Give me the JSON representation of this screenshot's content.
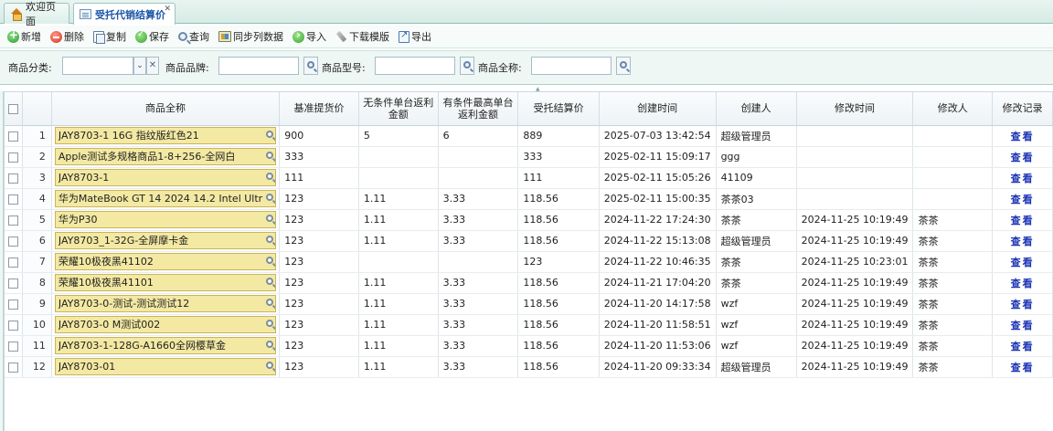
{
  "tabs": [
    {
      "label": "欢迎页面",
      "icon": "home-icon",
      "active": false
    },
    {
      "label": "受托代销结算价",
      "icon": "document-icon",
      "active": true
    }
  ],
  "toolbar": {
    "add": "新增",
    "delete": "删除",
    "copy": "复制",
    "save": "保存",
    "query": "查询",
    "sync": "同步列数据",
    "import": "导入",
    "download_template": "下载模版",
    "export": "导出"
  },
  "search": {
    "category_label": "商品分类:",
    "category_value": "",
    "brand_label": "商品品牌:",
    "brand_value": "",
    "model_label": "商品型号:",
    "model_value": "",
    "fullname_label": "商品全称:",
    "fullname_value": ""
  },
  "grid": {
    "columns": [
      "商品全称",
      "基准提货价",
      "无条件单台返利金额",
      "有条件最高单台返利金额",
      "受托结算价",
      "创建时间",
      "创建人",
      "修改时间",
      "修改人",
      "修改记录"
    ],
    "view_label": "查看",
    "rows": [
      {
        "no": "1",
        "name": "JAY8703-1 16G 指纹版红色21",
        "base_price": "900",
        "uncond_rebate": "5",
        "cond_rebate": "6",
        "settle_price": "889",
        "created": "2025-07-03 13:42:54",
        "creator": "超级管理员",
        "modified": "",
        "modifier": ""
      },
      {
        "no": "2",
        "name": "Apple测试多规格商品1-8+256-全网白",
        "base_price": "333",
        "uncond_rebate": "",
        "cond_rebate": "",
        "settle_price": "333",
        "created": "2025-02-11 15:09:17",
        "creator": "ggg",
        "modified": "",
        "modifier": ""
      },
      {
        "no": "3",
        "name": "JAY8703-1",
        "base_price": "111",
        "uncond_rebate": "",
        "cond_rebate": "",
        "settle_price": "111",
        "created": "2025-02-11 15:05:26",
        "creator": "41109",
        "modified": "",
        "modifier": ""
      },
      {
        "no": "4",
        "name": "华为MateBook GT 14 2024 14.2 Intel Ultr",
        "base_price": "123",
        "uncond_rebate": "1.11",
        "cond_rebate": "3.33",
        "settle_price": "118.56",
        "created": "2025-02-11 15:00:35",
        "creator": "茶茶03",
        "modified": "",
        "modifier": ""
      },
      {
        "no": "5",
        "name": "华为P30",
        "base_price": "123",
        "uncond_rebate": "1.11",
        "cond_rebate": "3.33",
        "settle_price": "118.56",
        "created": "2024-11-22 17:24:30",
        "creator": "茶茶",
        "modified": "2024-11-25 10:19:49",
        "modifier": "茶茶"
      },
      {
        "no": "6",
        "name": "JAY8703_1-32G-全屏摩卡金",
        "base_price": "123",
        "uncond_rebate": "1.11",
        "cond_rebate": "3.33",
        "settle_price": "118.56",
        "created": "2024-11-22 15:13:08",
        "creator": "超级管理员",
        "modified": "2024-11-25 10:19:49",
        "modifier": "茶茶"
      },
      {
        "no": "7",
        "name": "荣耀10极夜黑41102",
        "base_price": "123",
        "uncond_rebate": "",
        "cond_rebate": "",
        "settle_price": "123",
        "created": "2024-11-22 10:46:35",
        "creator": "茶茶",
        "modified": "2024-11-25 10:23:01",
        "modifier": "茶茶"
      },
      {
        "no": "8",
        "name": "荣耀10极夜黑41101",
        "base_price": "123",
        "uncond_rebate": "1.11",
        "cond_rebate": "3.33",
        "settle_price": "118.56",
        "created": "2024-11-21 17:04:20",
        "creator": "茶茶",
        "modified": "2024-11-25 10:19:49",
        "modifier": "茶茶"
      },
      {
        "no": "9",
        "name": "JAY8703-0-测试-测试测试12",
        "base_price": "123",
        "uncond_rebate": "1.11",
        "cond_rebate": "3.33",
        "settle_price": "118.56",
        "created": "2024-11-20 14:17:58",
        "creator": "wzf",
        "modified": "2024-11-25 10:19:49",
        "modifier": "茶茶"
      },
      {
        "no": "10",
        "name": "JAY8703-0 M测试002",
        "base_price": "123",
        "uncond_rebate": "1.11",
        "cond_rebate": "3.33",
        "settle_price": "118.56",
        "created": "2024-11-20 11:58:51",
        "creator": "wzf",
        "modified": "2024-11-25 10:19:49",
        "modifier": "茶茶"
      },
      {
        "no": "11",
        "name": "JAY8703-1-128G-A1660全网樱草金",
        "base_price": "123",
        "uncond_rebate": "1.11",
        "cond_rebate": "3.33",
        "settle_price": "118.56",
        "created": "2024-11-20 11:53:06",
        "creator": "wzf",
        "modified": "2024-11-25 10:19:49",
        "modifier": "茶茶"
      },
      {
        "no": "12",
        "name": "JAY8703-01",
        "base_price": "123",
        "uncond_rebate": "1.11",
        "cond_rebate": "3.33",
        "settle_price": "118.56",
        "created": "2024-11-20 09:33:34",
        "creator": "超级管理员",
        "modified": "2024-11-25 10:19:49",
        "modifier": "茶茶"
      }
    ]
  }
}
